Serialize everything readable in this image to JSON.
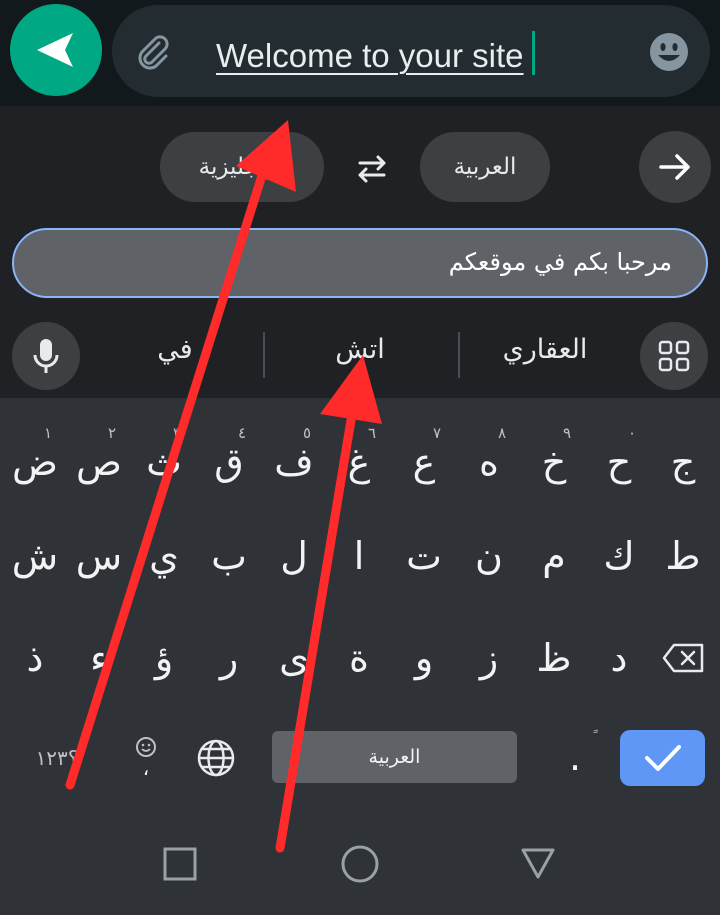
{
  "chat": {
    "message_text": "Welcome to your site",
    "send_icon": "send-icon",
    "attach_icon": "paperclip-icon",
    "emoji_icon": "emoji-icon",
    "accent_color": "#00a884"
  },
  "translate": {
    "source_language": "الإنجليزية",
    "target_language": "العربية",
    "swap_icon": "swap-arrows-icon",
    "next_icon": "arrow-right-icon",
    "translated_text": "مرحبا بكم في موقعكم",
    "field_border_color": "#8ab4f8"
  },
  "suggestions": {
    "mic_icon": "microphone-icon",
    "grid_icon": "apps-grid-icon",
    "items": [
      "العقاري",
      "اتش",
      "في"
    ]
  },
  "keyboard": {
    "row1": [
      {
        "char": "ج",
        "hint": ""
      },
      {
        "char": "ح",
        "hint": "٠"
      },
      {
        "char": "خ",
        "hint": "٩"
      },
      {
        "char": "ه",
        "hint": "٨"
      },
      {
        "char": "ع",
        "hint": "٧"
      },
      {
        "char": "غ",
        "hint": "٦"
      },
      {
        "char": "ف",
        "hint": "٥"
      },
      {
        "char": "ق",
        "hint": "٤"
      },
      {
        "char": "ث",
        "hint": "٣"
      },
      {
        "char": "ص",
        "hint": "٢"
      },
      {
        "char": "ض",
        "hint": "١"
      }
    ],
    "row2": [
      "ط",
      "ك",
      "م",
      "ن",
      "ت",
      "ا",
      "ل",
      "ب",
      "ي",
      "س",
      "ش"
    ],
    "row3": [
      "د",
      "ظ",
      "ز",
      "و",
      "ة",
      "ى",
      "ر",
      "ؤ",
      "ء",
      "ذ"
    ],
    "backspace_icon": "backspace-icon",
    "symbols_label": "؟١٢٣",
    "emoji_key_icon": "emoji-icon",
    "emoji_key_comma": "،",
    "globe_icon": "globe-icon",
    "space_label": "العربية",
    "period_label": ".",
    "period_hint": "ً",
    "enter_icon": "checkmark-icon",
    "enter_color": "#5e97f6"
  },
  "navigation": {
    "recents_icon": "square-recents-icon",
    "home_icon": "circle-home-icon",
    "back_icon": "triangle-back-icon"
  },
  "annotation_color": "#ff2a2a"
}
